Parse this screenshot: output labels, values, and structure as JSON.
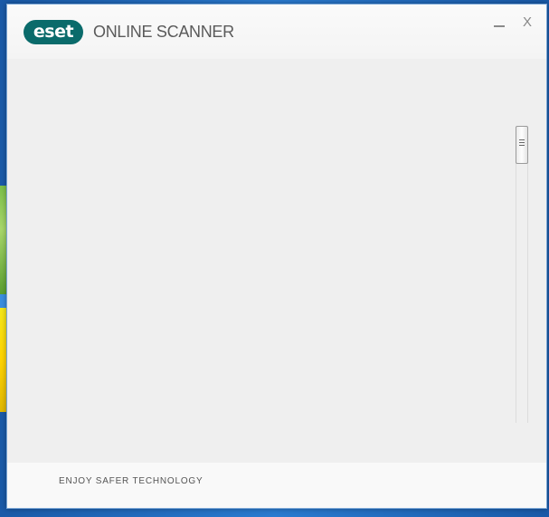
{
  "window": {
    "logo_text": "eset",
    "title": "ONLINE SCANNER",
    "minimize_label": "—",
    "close_label": "X"
  },
  "footer": {
    "tagline": "ENJOY SAFER TECHNOLOGY"
  },
  "colors": {
    "brand": "#0a6b6b",
    "title_text": "#5a5a5a",
    "content_bg": "#efefef"
  }
}
